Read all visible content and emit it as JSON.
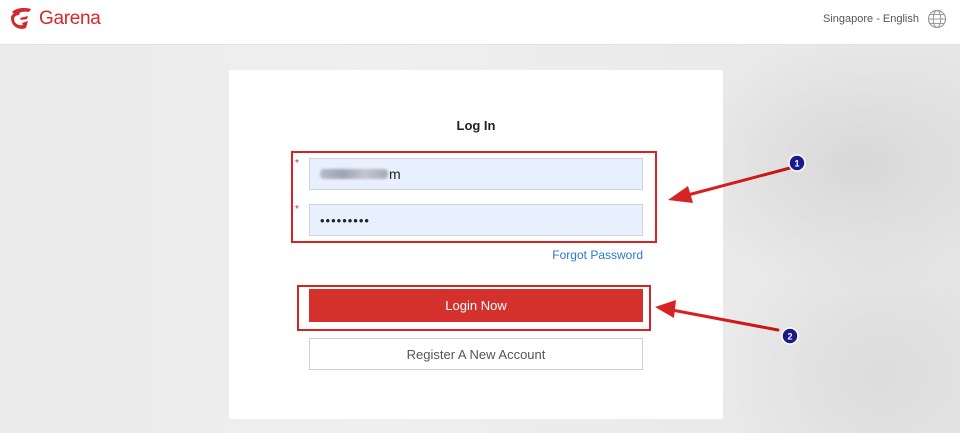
{
  "header": {
    "brand": "Garena",
    "region_label": "Singapore - English",
    "icons": {
      "logo": "garena-logo-icon",
      "globe": "globe-icon"
    }
  },
  "login": {
    "title": "Log In",
    "required_mark": "*",
    "username_suffix": "m",
    "password_mask": "•••••••••",
    "forgot_password": "Forgot Password",
    "login_button": "Login Now",
    "register_button": "Register A New Account"
  },
  "annotations": {
    "marker_1": "1",
    "marker_2": "2",
    "color": "#d62424",
    "badge_color": "#1a1a8c"
  },
  "colors": {
    "brand": "#d5272c",
    "login_button": "#d4302c",
    "link": "#2a7ad1",
    "field_fill": "#e8f0fe"
  }
}
